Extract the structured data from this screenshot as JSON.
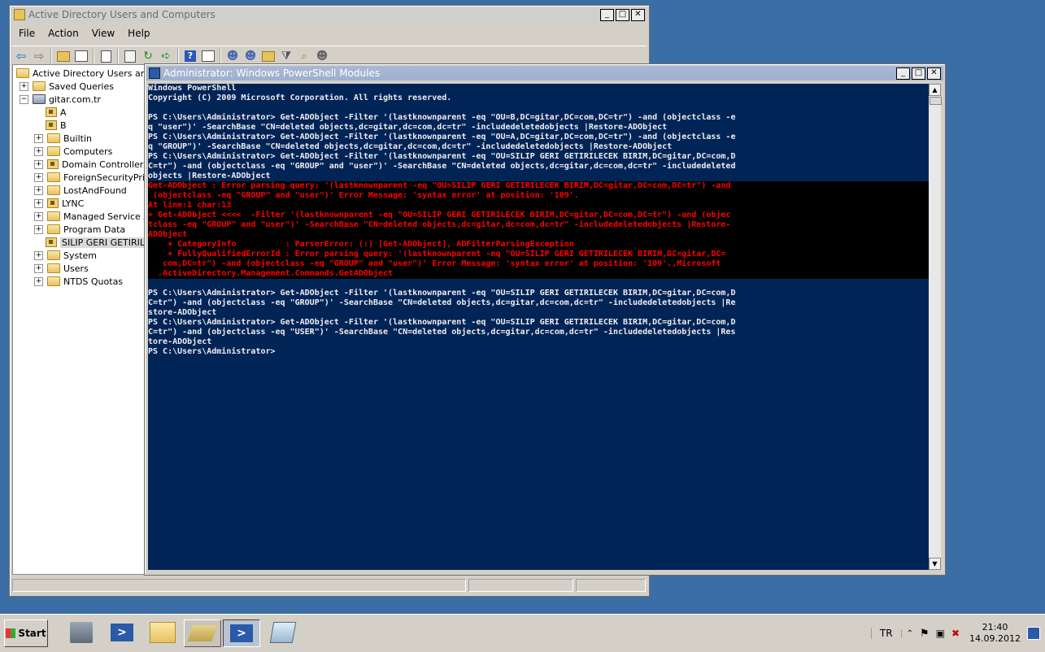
{
  "aduc": {
    "title": "Active Directory Users and Computers",
    "menu": [
      "File",
      "Action",
      "View",
      "Help"
    ],
    "tree": [
      {
        "label": "Active Directory Users and C",
        "level": 0,
        "expander": "",
        "icon": "aduc"
      },
      {
        "label": "Saved Queries",
        "level": 1,
        "expander": "+",
        "icon": "folder"
      },
      {
        "label": "gitar.com.tr",
        "level": 1,
        "expander": "−",
        "icon": "domain"
      },
      {
        "label": "A",
        "level": 2,
        "expander": "",
        "icon": "ou"
      },
      {
        "label": "B",
        "level": 2,
        "expander": "",
        "icon": "ou"
      },
      {
        "label": "Builtin",
        "level": 2,
        "expander": "+",
        "icon": "folder"
      },
      {
        "label": "Computers",
        "level": 2,
        "expander": "+",
        "icon": "folder"
      },
      {
        "label": "Domain Controllers",
        "level": 2,
        "expander": "+",
        "icon": "ou"
      },
      {
        "label": "ForeignSecurityPrinc",
        "level": 2,
        "expander": "+",
        "icon": "folder"
      },
      {
        "label": "LostAndFound",
        "level": 2,
        "expander": "+",
        "icon": "folder"
      },
      {
        "label": "LYNC",
        "level": 2,
        "expander": "+",
        "icon": "ou"
      },
      {
        "label": "Managed Service Ac",
        "level": 2,
        "expander": "+",
        "icon": "folder"
      },
      {
        "label": "Program Data",
        "level": 2,
        "expander": "+",
        "icon": "folder"
      },
      {
        "label": "SILIP GERI GETIRILE",
        "level": 2,
        "expander": "",
        "icon": "ou",
        "selected": true
      },
      {
        "label": "System",
        "level": 2,
        "expander": "+",
        "icon": "folder"
      },
      {
        "label": "Users",
        "level": 2,
        "expander": "+",
        "icon": "folder"
      },
      {
        "label": "NTDS Quotas",
        "level": 2,
        "expander": "+",
        "icon": "folder"
      }
    ]
  },
  "powershell": {
    "title": "Administrator: Windows PowerShell Modules",
    "lines": [
      {
        "text": "Windows PowerShell",
        "kind": "normal"
      },
      {
        "text": "Copyright (C) 2009 Microsoft Corporation. All rights reserved.",
        "kind": "normal"
      },
      {
        "text": "",
        "kind": "normal"
      },
      {
        "text": "PS C:\\Users\\Administrator> Get-ADObject -Filter '(lastknownparent -eq \"OU=B,DC=gitar,DC=com,DC=tr\") -and (objectclass -e",
        "kind": "normal"
      },
      {
        "text": "q \"user\")' -SearchBase \"CN=deleted objects,dc=gitar,dc=com,dc=tr\" -includedeletedobjects |Restore-ADObject",
        "kind": "normal"
      },
      {
        "text": "PS C:\\Users\\Administrator> Get-ADObject -Filter '(lastknownparent -eq \"OU=A,DC=gitar,DC=com,DC=tr\") -and (objectclass -e",
        "kind": "normal"
      },
      {
        "text": "q \"GROUP\")' -SearchBase \"CN=deleted objects,dc=gitar,dc=com,dc=tr\" -includedeletedobjects |Restore-ADObject",
        "kind": "normal"
      },
      {
        "text": "PS C:\\Users\\Administrator> Get-ADObject -Filter '(lastknownparent -eq \"OU=SILIP GERI GETIRILECEK BIRIM,DC=gitar,DC=com,D",
        "kind": "normal"
      },
      {
        "text": "C=tr\") -and (objectclass -eq \"GROUP\" and \"user\")' -SearchBase \"CN=deleted objects,dc=gitar,dc=com,dc=tr\" -includedeleted",
        "kind": "normal"
      },
      {
        "text": "objects |Restore-ADObject",
        "kind": "normal"
      },
      {
        "text": "Get-ADObject : Error parsing query: '(lastknownparent -eq \"OU=SILIP GERI GETIRILECEK BIRIM,DC=gitar,DC=com,DC=tr\") -and",
        "kind": "err"
      },
      {
        "text": " (objectclass -eq \"GROUP\" and \"user\")' Error Message: 'syntax error' at position: '109'.",
        "kind": "err"
      },
      {
        "text": "At line:1 char:13",
        "kind": "err"
      },
      {
        "text": "+ Get-ADObject <<<<  -Filter '(lastknownparent -eq \"OU=SILIP GERI GETIRILECEK BIRIM,DC=gitar,DC=com,DC=tr\") -and (objec",
        "kind": "err"
      },
      {
        "text": "tclass -eq \"GROUP\" and \"user\")' -SearchBase \"CN=deleted objects,dc=gitar,dc=com,dc=tr\" -includedeletedobjects |Restore-",
        "kind": "err"
      },
      {
        "text": "ADObject",
        "kind": "err"
      },
      {
        "text": "    + CategoryInfo          : ParserError: (:) [Get-ADObject], ADFilterParsingException",
        "kind": "err"
      },
      {
        "text": "    + FullyQualifiedErrorId : Error parsing query: '(lastknownparent -eq \"OU=SILIP GERI GETIRILECEK BIRIM,DC=gitar,DC=",
        "kind": "err"
      },
      {
        "text": "   com,DC=tr\") -and (objectclass -eq \"GROUP\" and \"user\")' Error Message: 'syntax error' at position: '109'.,Microsoft",
        "kind": "err"
      },
      {
        "text": "  .ActiveDirectory.Management.Commands.GetADObject",
        "kind": "err"
      },
      {
        "text": "",
        "kind": "normal"
      },
      {
        "text": "PS C:\\Users\\Administrator> Get-ADObject -Filter '(lastknownparent -eq \"OU=SILIP GERI GETIRILECEK BIRIM,DC=gitar,DC=com,D",
        "kind": "normal"
      },
      {
        "text": "C=tr\") -and (objectclass -eq \"GROUP\")' -SearchBase \"CN=deleted objects,dc=gitar,dc=com,dc=tr\" -includedeletedobjects |Re",
        "kind": "normal"
      },
      {
        "text": "store-ADObject",
        "kind": "normal"
      },
      {
        "text": "PS C:\\Users\\Administrator> Get-ADObject -Filter '(lastknownparent -eq \"OU=SILIP GERI GETIRILECEK BIRIM,DC=gitar,DC=com,D",
        "kind": "normal"
      },
      {
        "text": "C=tr\") -and (objectclass -eq \"USER\")' -SearchBase \"CN=deleted objects,dc=gitar,dc=com,dc=tr\" -includedeletedobjects |Res",
        "kind": "normal"
      },
      {
        "text": "tore-ADObject",
        "kind": "normal"
      },
      {
        "text": "PS C:\\Users\\Administrator>",
        "kind": "normal"
      }
    ]
  },
  "taskbar": {
    "start_label": "Start",
    "apps": [
      "server-manager-icon",
      "powershell-icon",
      "explorer-icon",
      "aduc-icon",
      "powershell-admin-icon",
      "notepad-icon"
    ],
    "language": "TR",
    "time": "21:40",
    "date": "14.09.2012"
  },
  "colors": {
    "desktop": "#3a6ea5",
    "console_bg": "#012456",
    "console_fg": "#eeedf0",
    "error_fg": "#ff0000"
  }
}
